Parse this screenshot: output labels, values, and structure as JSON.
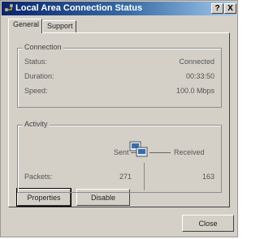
{
  "window": {
    "title": "Local Area Connection Status"
  },
  "titlebar_buttons": {
    "help": "?",
    "close": "X"
  },
  "tabs": [
    {
      "label": "General"
    },
    {
      "label": "Support"
    }
  ],
  "connection": {
    "legend": "Connection",
    "rows": [
      {
        "label": "Status:",
        "value": "Connected"
      },
      {
        "label": "Duration:",
        "value": "00:33:50"
      },
      {
        "label": "Speed:",
        "value": "100.0 Mbps"
      }
    ]
  },
  "activity": {
    "legend": "Activity",
    "sent_label": "Sent",
    "received_label": "Received",
    "packets_label": "Packets:",
    "packets_sent": "271",
    "packets_received": "163"
  },
  "buttons": {
    "properties": "Properties",
    "disable": "Disable",
    "close": "Close"
  }
}
